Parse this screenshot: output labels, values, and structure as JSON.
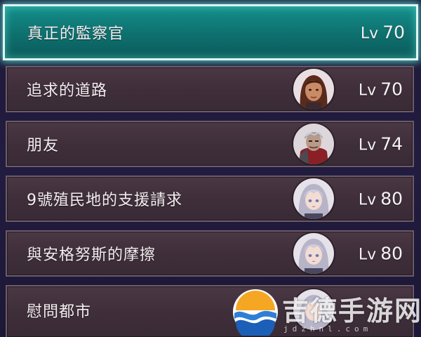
{
  "quest_list": {
    "items": [
      {
        "title": "真正的監察官",
        "level_prefix": "Lv",
        "level": "70",
        "selected": true,
        "avatar": "none"
      },
      {
        "title": "追求的道路",
        "level_prefix": "Lv",
        "level": "70",
        "selected": false,
        "avatar": "brown-haired-woman-portrait"
      },
      {
        "title": "朋友",
        "level_prefix": "Lv",
        "level": "74",
        "selected": false,
        "avatar": "armored-grey-haired-man-portrait"
      },
      {
        "title": "9號殖民地的支援請求",
        "level_prefix": "Lv",
        "level": "80",
        "selected": false,
        "avatar": "silver-haired-girl-portrait"
      },
      {
        "title": "與安格努斯的摩擦",
        "level_prefix": "Lv",
        "level": "80",
        "selected": false,
        "avatar": "silver-haired-girl-portrait"
      },
      {
        "title": "慰問都市",
        "level_prefix": "",
        "level": "",
        "selected": false,
        "avatar": "silver-haired-girl-portrait"
      }
    ]
  },
  "watermark": {
    "brand": "吉德手游网",
    "url": "jdzhnl.com",
    "logo_icon": "wave-sun-logo-icon"
  },
  "colors": {
    "selected_fill": "#0f7573",
    "selected_glow": "#5ae6dc",
    "row_fill": "#3e2e3a",
    "row_border": "#6c5c66",
    "background": "#1e1a3a"
  }
}
